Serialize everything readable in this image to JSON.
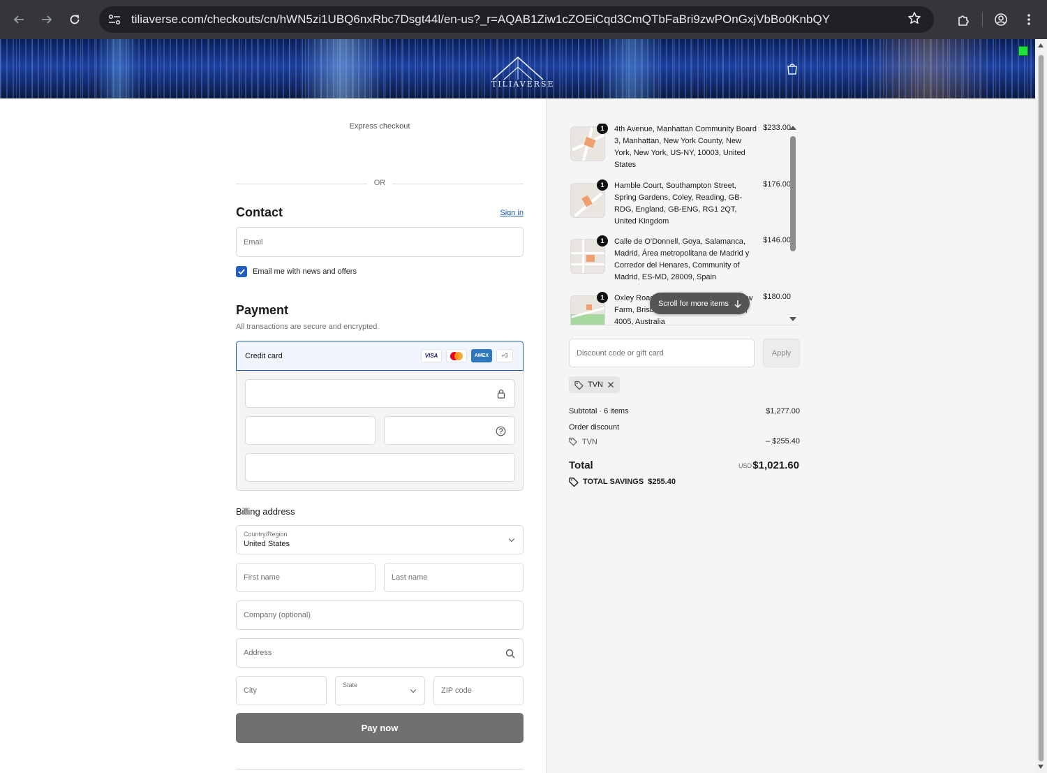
{
  "browser": {
    "url": "tiliaverse.com/checkouts/cn/hWN5zi1UBQ6nxRbc7Dsgt44l/en-us?_r=AQAB1Ziw1cZOEiCqd3CmQTbFaBri9zwPOnGxjVbBo0KnbQY"
  },
  "banner": {
    "logo_text": "TILIAVERSE"
  },
  "express": {
    "label": "Express checkout",
    "or": "OR"
  },
  "contact": {
    "title": "Contact",
    "sign_in": "Sign in",
    "email_placeholder": "Email",
    "newsletter_label": "Email me with news and offers",
    "newsletter_checked": true
  },
  "payment": {
    "title": "Payment",
    "subtitle": "All transactions are secure and encrypted.",
    "method_label": "Credit card",
    "card_logos": [
      "VISA",
      "mastercard",
      "AMEX",
      "+3"
    ]
  },
  "billing": {
    "title": "Billing address",
    "country_label": "Country/Region",
    "country_value": "United States",
    "first_name": "First name",
    "last_name": "Last name",
    "company": "Company (optional)",
    "address": "Address",
    "city": "City",
    "state_label": "State",
    "zip": "ZIP code"
  },
  "pay_button": "Pay now",
  "cart": {
    "items": [
      {
        "qty": "1",
        "desc": "4th Avenue, Manhattan Community Board 3, Manhattan, New York County, New York, New York, US-NY, 10003, United States",
        "price": "$233.00"
      },
      {
        "qty": "1",
        "desc": "Hamble Court, Southampton Street, Spring Gardens, Coley, Reading, GB-RDG, England, GB-ENG, RG1 2QT, United Kingdom",
        "price": "$176.00"
      },
      {
        "qty": "1",
        "desc": "Calle de O'Donnell, Goya, Salamanca, Madrid, Área metropolitana de Madrid y Corredor del Henares, Community of Madrid, ES-MD, 28009, Spain",
        "price": "$146.00"
      },
      {
        "qty": "1",
        "desc": "Oxley Road, Taringa, Brisbane City, New Farm, Brisbane, Queensland, AU-QLD, 4005, Australia",
        "price": "$180.00"
      }
    ],
    "scroll_hint": "Scroll for more items",
    "discount_placeholder": "Discount code or gift card",
    "apply_label": "Apply",
    "applied_code": "TVN",
    "subtotal_label": "Subtotal · 6 items",
    "subtotal_value": "$1,277.00",
    "order_discount_label": "Order discount",
    "discount_code": "TVN",
    "discount_value": "– $255.40",
    "total_label": "Total",
    "currency": "USD",
    "total_value": "$1,021.60",
    "savings_label": "TOTAL SAVINGS",
    "savings_value": "$255.40"
  }
}
